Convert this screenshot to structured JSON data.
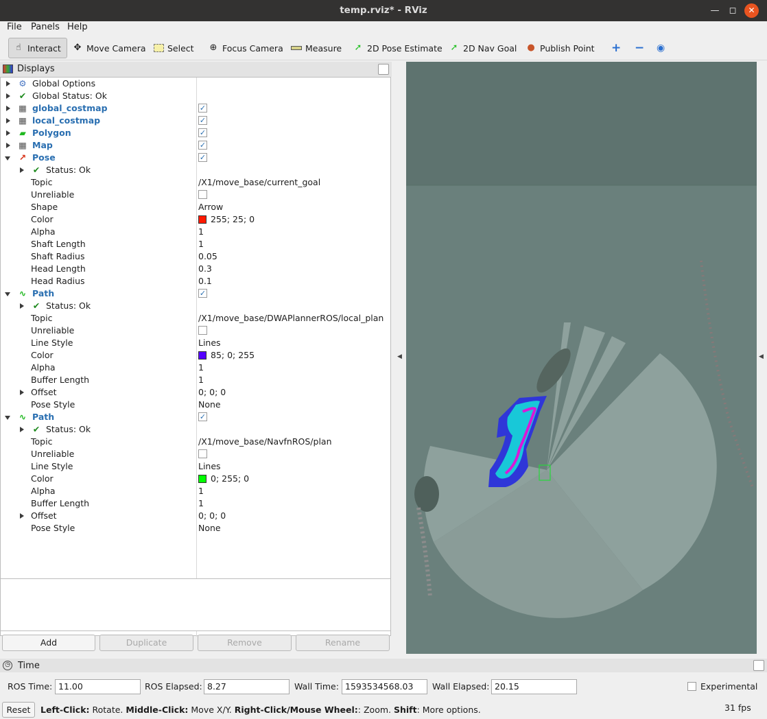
{
  "window": {
    "title": "temp.rviz* - RViz"
  },
  "menu": {
    "file": "File",
    "panels": "Panels",
    "help": "Help"
  },
  "toolbar": {
    "interact": "Interact",
    "move_camera": "Move Camera",
    "select": "Select",
    "focus_camera": "Focus Camera",
    "measure": "Measure",
    "pose_estimate": "2D Pose Estimate",
    "nav_goal": "2D Nav Goal",
    "publish_point": "Publish Point"
  },
  "displays": {
    "title": "Displays",
    "global_options": "Global Options",
    "global_status": "Global Status: Ok",
    "items": {
      "global_costmap": "global_costmap",
      "local_costmap": "local_costmap",
      "polygon": "Polygon",
      "map": "Map"
    },
    "pose": {
      "name": "Pose",
      "status": "Status: Ok",
      "props": [
        {
          "label": "Topic",
          "value": "/X1/move_base/current_goal"
        },
        {
          "label": "Unreliable",
          "value": ""
        },
        {
          "label": "Shape",
          "value": "Arrow"
        },
        {
          "label": "Color",
          "value": "255; 25; 0",
          "swatch": "#ff1900"
        },
        {
          "label": "Alpha",
          "value": "1"
        },
        {
          "label": "Shaft Length",
          "value": "1"
        },
        {
          "label": "Shaft Radius",
          "value": "0.05"
        },
        {
          "label": "Head Length",
          "value": "0.3"
        },
        {
          "label": "Head Radius",
          "value": "0.1"
        }
      ]
    },
    "path1": {
      "name": "Path",
      "status": "Status: Ok",
      "props": [
        {
          "label": "Topic",
          "value": "/X1/move_base/DWAPlannerROS/local_plan"
        },
        {
          "label": "Unreliable",
          "value": ""
        },
        {
          "label": "Line Style",
          "value": "Lines"
        },
        {
          "label": "Color",
          "value": "85; 0; 255",
          "swatch": "#5500ff"
        },
        {
          "label": "Alpha",
          "value": "1"
        },
        {
          "label": "Buffer Length",
          "value": "1"
        },
        {
          "label": "Offset",
          "value": "0; 0; 0"
        },
        {
          "label": "Pose Style",
          "value": "None"
        }
      ]
    },
    "path2": {
      "name": "Path",
      "status": "Status: Ok",
      "props": [
        {
          "label": "Topic",
          "value": "/X1/move_base/NavfnROS/plan"
        },
        {
          "label": "Unreliable",
          "value": ""
        },
        {
          "label": "Line Style",
          "value": "Lines"
        },
        {
          "label": "Color",
          "value": "0; 255; 0",
          "swatch": "#00ff00"
        },
        {
          "label": "Alpha",
          "value": "1"
        },
        {
          "label": "Buffer Length",
          "value": "1"
        },
        {
          "label": "Offset",
          "value": "0; 0; 0"
        },
        {
          "label": "Pose Style",
          "value": "None"
        }
      ]
    },
    "buttons": {
      "add": "Add",
      "duplicate": "Duplicate",
      "remove": "Remove",
      "rename": "Rename"
    }
  },
  "time": {
    "title": "Time",
    "ros_time_label": "ROS Time:",
    "ros_time": "11.00",
    "ros_elapsed_label": "ROS Elapsed:",
    "ros_elapsed": "8.27",
    "wall_time_label": "Wall Time:",
    "wall_time": "1593534568.03",
    "wall_elapsed_label": "Wall Elapsed:",
    "wall_elapsed": "20.15",
    "experimental": "Experimental"
  },
  "status": {
    "reset": "Reset",
    "hint_b1": "Left-Click:",
    "hint_t1": " Rotate. ",
    "hint_b2": "Middle-Click:",
    "hint_t2": " Move X/Y. ",
    "hint_b3": "Right-Click/Mouse Wheel:",
    "hint_t3": ": Zoom. ",
    "hint_b4": "Shift",
    "hint_t4": ": More options.",
    "fps": "31 fps"
  }
}
